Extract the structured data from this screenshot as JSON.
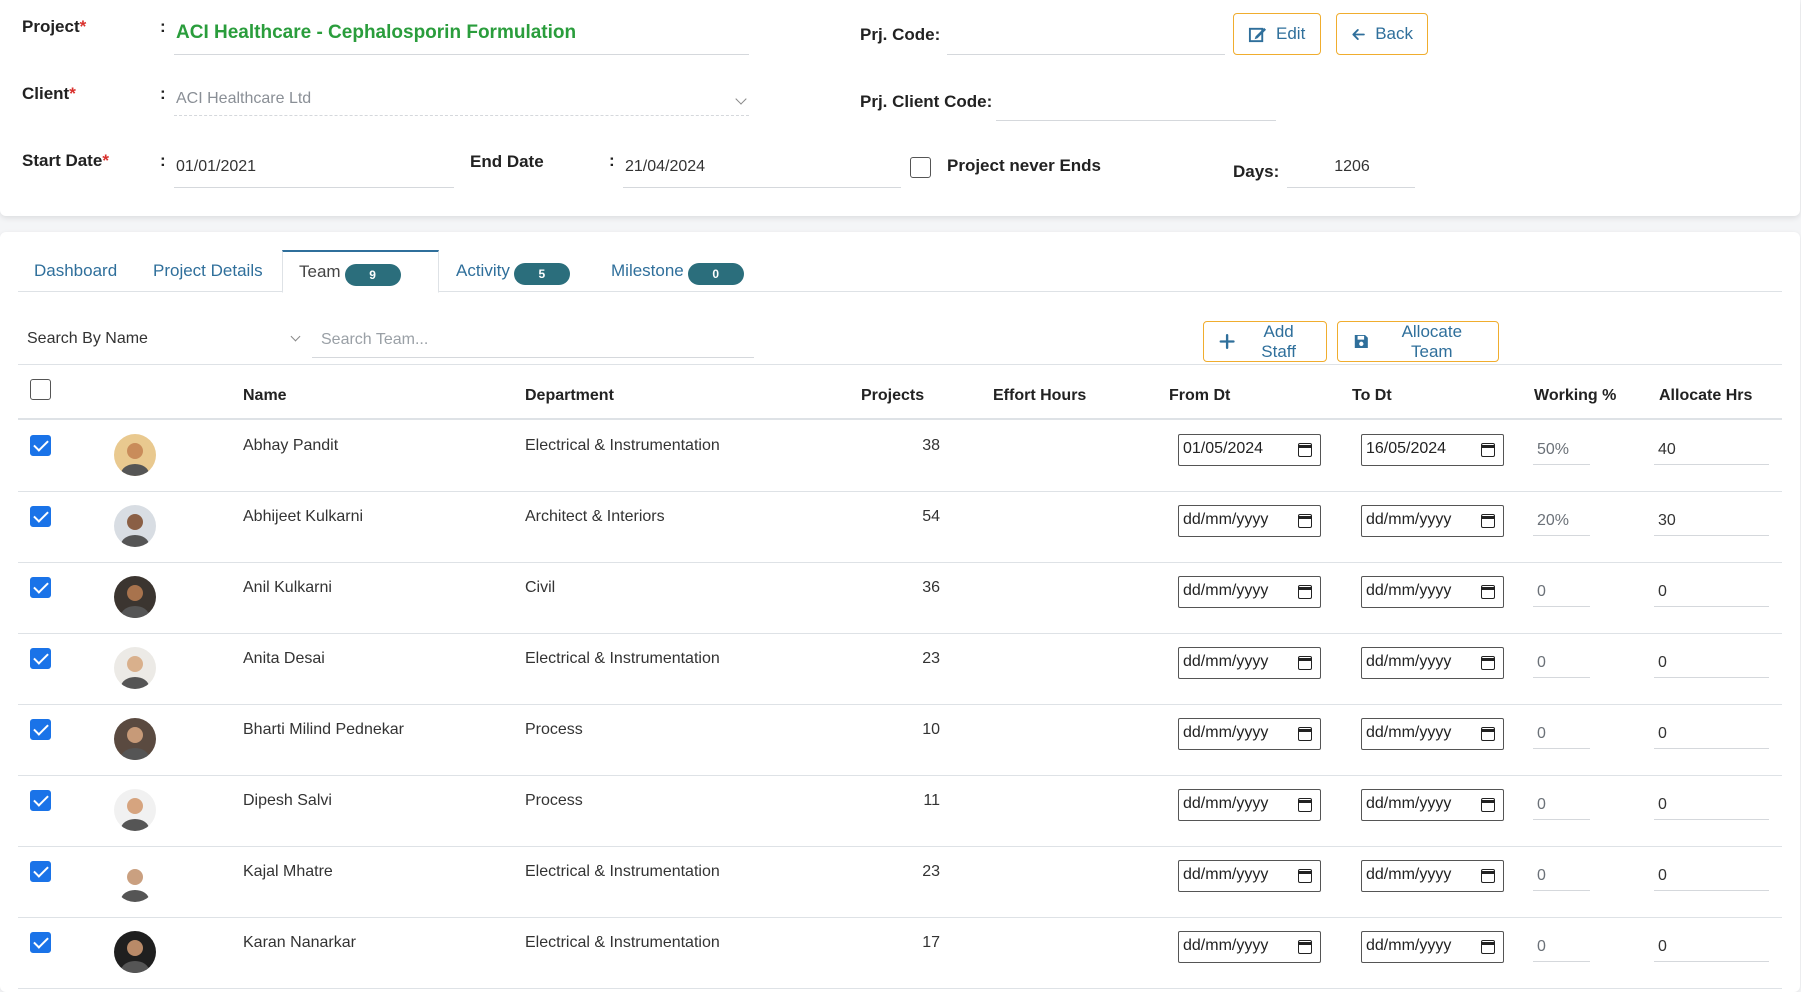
{
  "form": {
    "project_label": "Project",
    "project_value": "ACI Healthcare - Cephalosporin Formulation",
    "client_label": "Client",
    "client_value": "ACI Healthcare Ltd",
    "start_label": "Start Date",
    "start_value": "01/01/2021",
    "end_label": "End Date",
    "end_value": "21/04/2024",
    "never_ends_label": "Project never Ends",
    "prj_code_label": "Prj. Code:",
    "prj_client_code_label": "Prj. Client Code:",
    "days_label": "Days:",
    "days_value": "1206",
    "required_mark": "*",
    "colon": ":"
  },
  "toolbar": {
    "edit_label": "Edit",
    "back_label": "Back"
  },
  "tabs": [
    {
      "label": "Dashboard",
      "badge": ""
    },
    {
      "label": "Project Details",
      "badge": ""
    },
    {
      "label": "Team",
      "badge": "9"
    },
    {
      "label": "Activity",
      "badge": "5"
    },
    {
      "label": "Milestone",
      "badge": "0"
    }
  ],
  "search": {
    "by_label": "Search By Name",
    "placeholder": "Search Team...",
    "add_staff_label": "Add Staff",
    "allocate_team_label": "Allocate Team"
  },
  "table": {
    "headers": [
      "Name",
      "Department",
      "Projects",
      "Effort Hours",
      "From Dt",
      "To Dt",
      "Working %",
      "Allocate Hrs"
    ],
    "date_placeholder": "dd/mm/yyyy",
    "rows": [
      {
        "name": "Abhay Pandit",
        "department": "Electrical & Instrumentation",
        "projects": "38",
        "from": "01/05/2024",
        "to": "16/05/2024",
        "working": "50%",
        "hours": "40",
        "avatar_bg": "#e9c98f",
        "face": "#c98c5a"
      },
      {
        "name": "Abhijeet Kulkarni",
        "department": "Architect & Interiors",
        "projects": "54",
        "from": "dd/mm/yyyy",
        "to": "dd/mm/yyyy",
        "working": "20%",
        "hours": "30",
        "avatar_bg": "#d8dde3",
        "face": "#8a5f45"
      },
      {
        "name": "Anil Kulkarni",
        "department": "Civil",
        "projects": "36",
        "from": "dd/mm/yyyy",
        "to": "dd/mm/yyyy",
        "working": "0",
        "hours": "0",
        "avatar_bg": "#3b3530",
        "face": "#a8734d"
      },
      {
        "name": "Anita Desai",
        "department": "Electrical & Instrumentation",
        "projects": "23",
        "from": "dd/mm/yyyy",
        "to": "dd/mm/yyyy",
        "working": "0",
        "hours": "0",
        "avatar_bg": "#eceae6",
        "face": "#d9b08c"
      },
      {
        "name": "Bharti Milind Pednekar",
        "department": "Process",
        "projects": "10",
        "from": "dd/mm/yyyy",
        "to": "dd/mm/yyyy",
        "working": "0",
        "hours": "0",
        "avatar_bg": "#5a4a40",
        "face": "#c79a78"
      },
      {
        "name": "Dipesh Salvi",
        "department": "Process",
        "projects": "11",
        "from": "dd/mm/yyyy",
        "to": "dd/mm/yyyy",
        "working": "0",
        "hours": "0",
        "avatar_bg": "#f1f1f1",
        "face": "#d6a47f"
      },
      {
        "name": "Kajal Mhatre",
        "department": "Electrical & Instrumentation",
        "projects": "23",
        "from": "dd/mm/yyyy",
        "to": "dd/mm/yyyy",
        "working": "0",
        "hours": "0",
        "avatar_bg": "#ffffff",
        "face": "#caa080"
      },
      {
        "name": "Karan Nanarkar",
        "department": "Electrical & Instrumentation",
        "projects": "17",
        "from": "dd/mm/yyyy",
        "to": "dd/mm/yyyy",
        "working": "0",
        "hours": "0",
        "avatar_bg": "#1f1f1f",
        "face": "#b98a68"
      }
    ]
  }
}
